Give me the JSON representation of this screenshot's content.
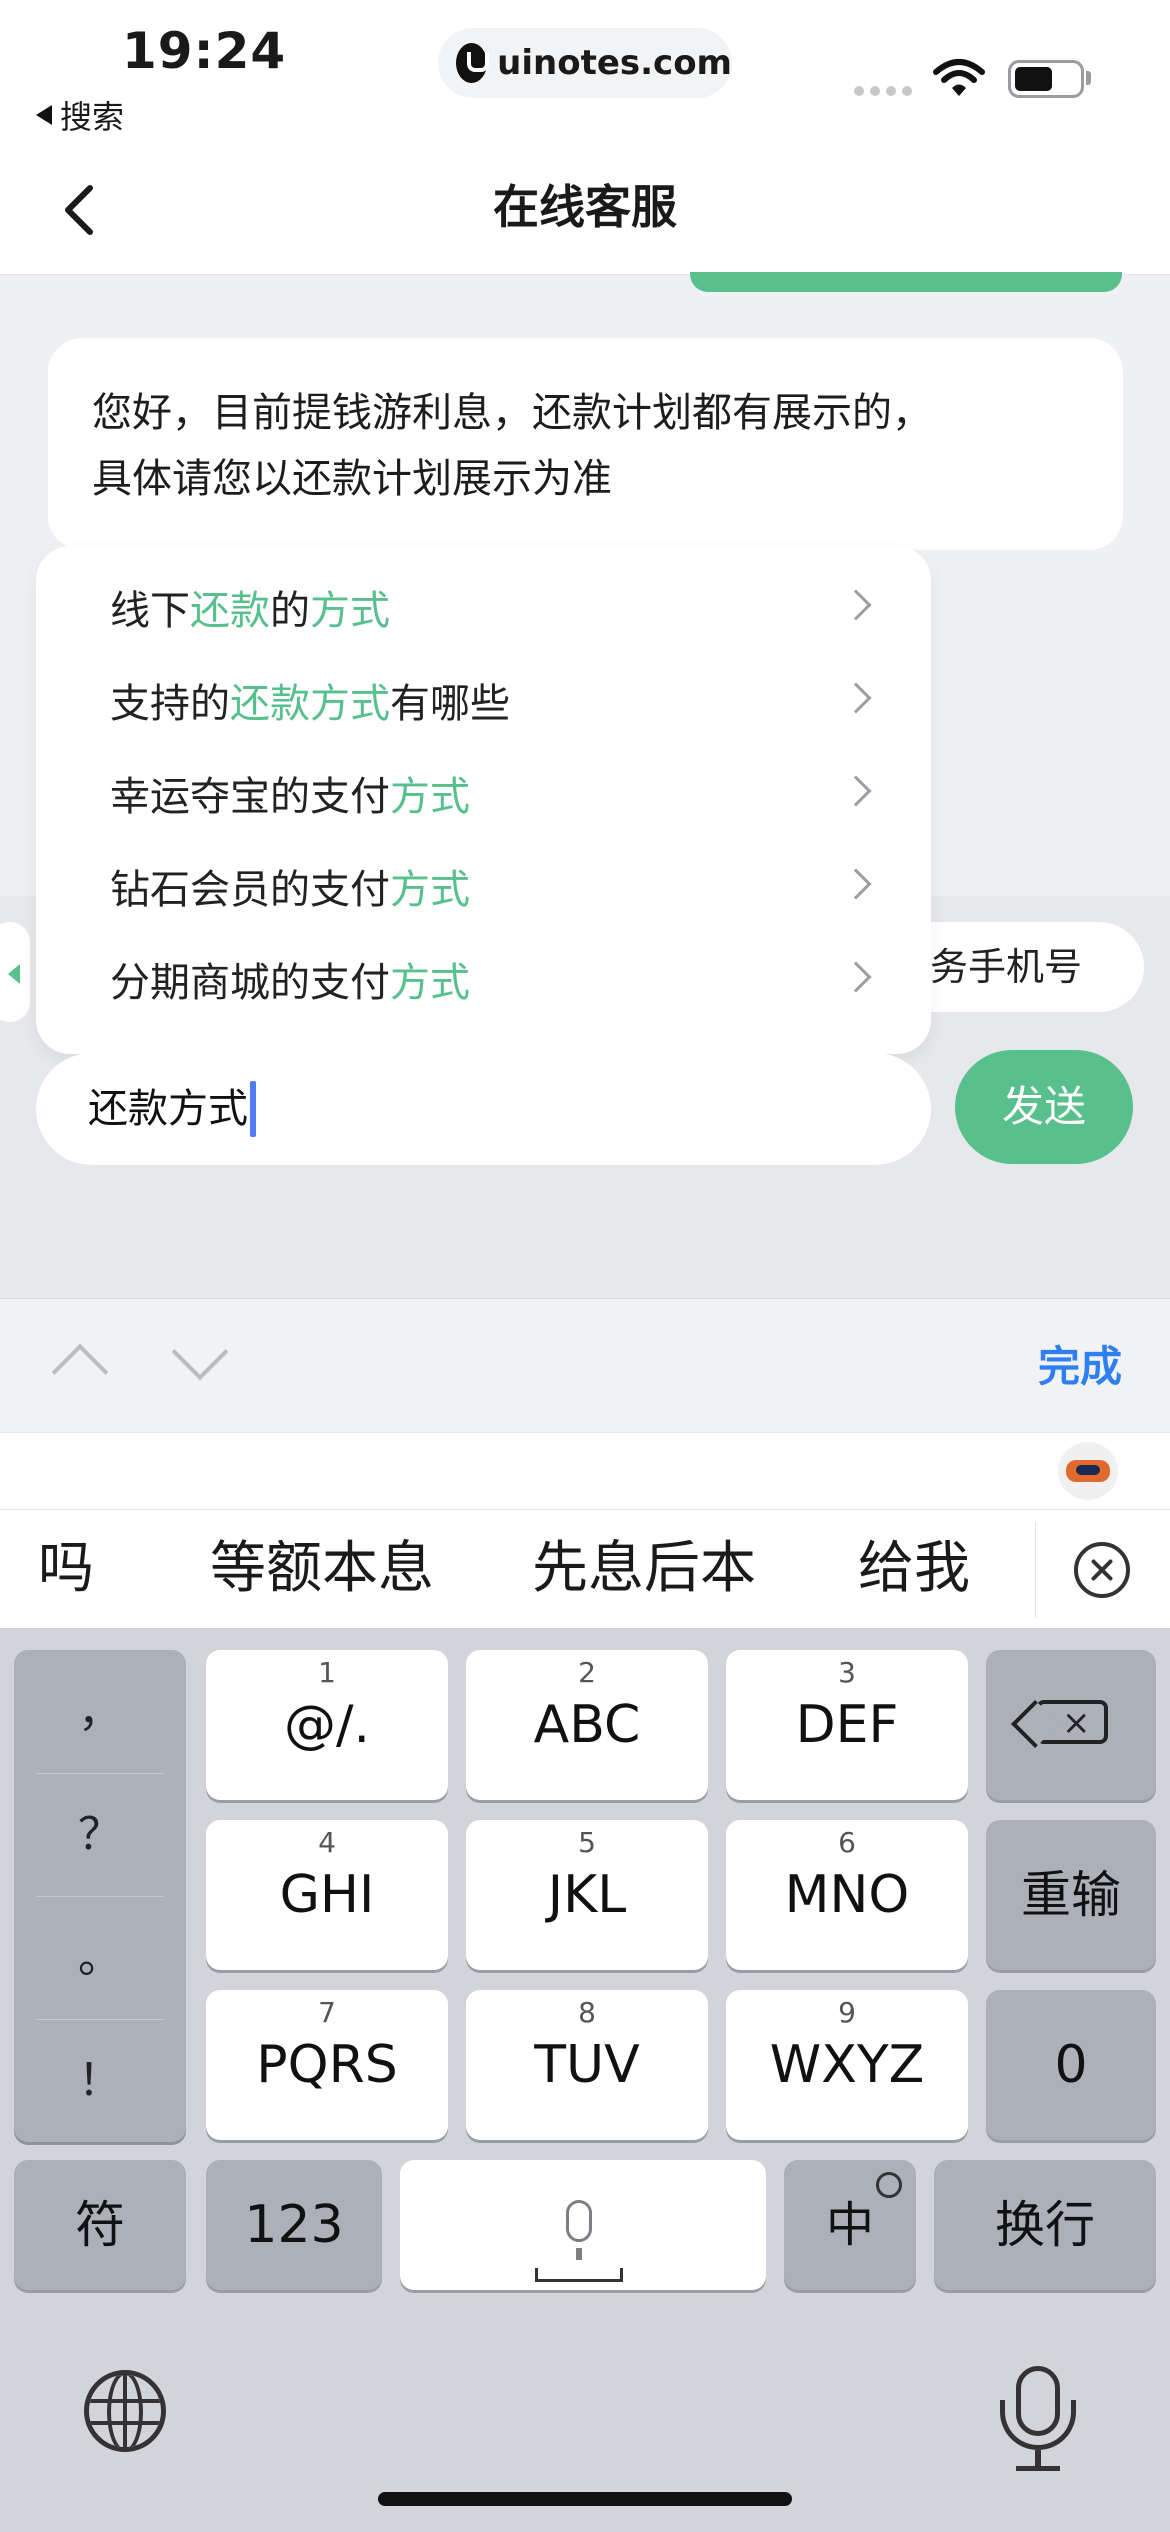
{
  "status_bar": {
    "time": "19:24",
    "back_app": "搜索",
    "url": "uinotes.com",
    "battery_level": 0.6
  },
  "nav": {
    "title": "在线客服"
  },
  "chat": {
    "message_line1": "您好，目前提钱游利息，还款计划都有展示的，",
    "message_line2": "具体请您以还款计划展示为准",
    "quick_chip": "业务手机号"
  },
  "suggestions": [
    {
      "parts": [
        {
          "text": "线下",
          "hl": false
        },
        {
          "text": "还款",
          "hl": true
        },
        {
          "text": "的",
          "hl": false
        },
        {
          "text": "方式",
          "hl": true
        }
      ]
    },
    {
      "parts": [
        {
          "text": "支持的",
          "hl": false
        },
        {
          "text": "还款方式",
          "hl": true
        },
        {
          "text": "有哪些",
          "hl": false
        }
      ]
    },
    {
      "parts": [
        {
          "text": "幸运夺宝的支付",
          "hl": false
        },
        {
          "text": "方式",
          "hl": true
        }
      ]
    },
    {
      "parts": [
        {
          "text": "钻石会员的支付",
          "hl": false
        },
        {
          "text": "方式",
          "hl": true
        }
      ]
    },
    {
      "parts": [
        {
          "text": "分期商城的支付",
          "hl": false
        },
        {
          "text": "方式",
          "hl": true
        }
      ]
    }
  ],
  "input": {
    "value": "还款方式",
    "send_label": "发送"
  },
  "toolbar": {
    "done_label": "完成"
  },
  "candidates": [
    "吗",
    "等额本息",
    "先息后本",
    "给我"
  ],
  "keyboard": {
    "punct": [
      "，",
      "？",
      "。",
      "！"
    ],
    "keys": [
      {
        "num": "1",
        "label": "@/."
      },
      {
        "num": "2",
        "label": "ABC"
      },
      {
        "num": "3",
        "label": "DEF"
      },
      {
        "num": "4",
        "label": "GHI"
      },
      {
        "num": "5",
        "label": "JKL"
      },
      {
        "num": "6",
        "label": "MNO"
      },
      {
        "num": "7",
        "label": "PQRS"
      },
      {
        "num": "8",
        "label": "TUV"
      },
      {
        "num": "9",
        "label": "WXYZ"
      }
    ],
    "reenter": "重输",
    "zero": "0",
    "symbols": "符",
    "numbers": "123",
    "lang": "中",
    "enter": "换行"
  },
  "colors": {
    "accent": "#58c08c",
    "link": "#2f7ff0",
    "caret": "#4f7df3"
  },
  "icons": {
    "nav_back": "chevron-left-icon",
    "suggestion_arrow": "chevron-right-icon",
    "backspace": "backspace-icon",
    "globe": "globe-icon",
    "mic": "mic-icon",
    "close": "close-circle-icon"
  }
}
